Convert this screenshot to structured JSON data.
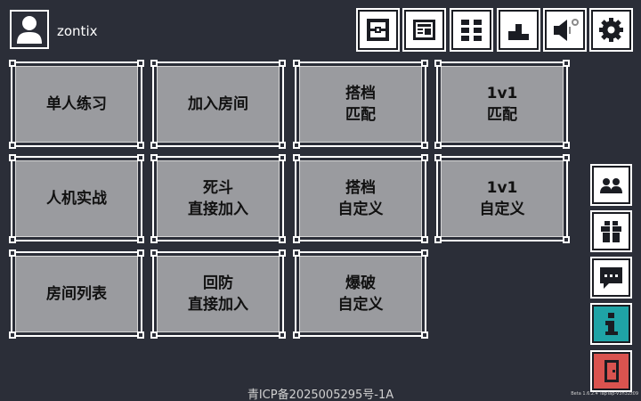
{
  "user": {
    "name": "zontix"
  },
  "top_buttons": [
    {
      "name": "store-icon"
    },
    {
      "name": "news-icon"
    },
    {
      "name": "grid-menu-icon"
    },
    {
      "name": "leaderboard-icon"
    },
    {
      "name": "sound-icon"
    },
    {
      "name": "settings-icon"
    }
  ],
  "tiles": [
    {
      "id": "solo-practice",
      "lines": [
        "单人练习"
      ]
    },
    {
      "id": "join-room",
      "lines": [
        "加入房间"
      ]
    },
    {
      "id": "duo-match",
      "lines": [
        "搭档",
        "匹配"
      ]
    },
    {
      "id": "1v1-match",
      "lines": [
        "1v1",
        "匹配"
      ]
    },
    {
      "id": "vs-ai",
      "lines": [
        "人机实战"
      ]
    },
    {
      "id": "deathmatch-join",
      "lines": [
        "死斗",
        "直接加入"
      ]
    },
    {
      "id": "duo-custom",
      "lines": [
        "搭档",
        "自定义"
      ]
    },
    {
      "id": "1v1-custom",
      "lines": [
        "1v1",
        "自定义"
      ]
    },
    {
      "id": "room-list",
      "lines": [
        "房间列表"
      ]
    },
    {
      "id": "defense-join",
      "lines": [
        "回防",
        "直接加入"
      ]
    },
    {
      "id": "demolition-custom",
      "lines": [
        "爆破",
        "自定义"
      ]
    }
  ],
  "side_buttons": [
    {
      "name": "friends-icon",
      "color": "#ffffff"
    },
    {
      "name": "gift-icon",
      "color": "#ffffff"
    },
    {
      "name": "chat-icon",
      "color": "#ffffff"
    },
    {
      "name": "info-icon",
      "color": "#1fa3a6"
    },
    {
      "name": "exit-door-icon",
      "color": "#d9534f"
    }
  ],
  "footer": {
    "icp": "青ICP备2025005295号-1A",
    "version": "Beta 1.6.2.4 TapTap-V3h32z09"
  }
}
